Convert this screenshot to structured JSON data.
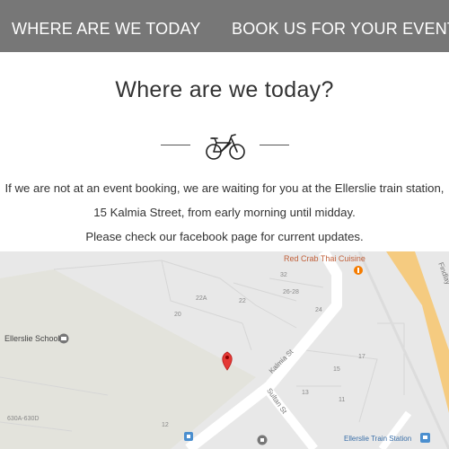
{
  "nav": {
    "left_label": "WHERE ARE WE TODAY",
    "right_label": "BOOK US FOR YOUR EVENT"
  },
  "main": {
    "title": "Where are we today?",
    "divider_icon": "bicycle-icon",
    "paragraph_1": "If we are not at an event booking, we are waiting for you at the Ellerslie train station,",
    "paragraph_2": "15 Kalmia Street, from early morning until midday.",
    "paragraph_3": "Please check our facebook page for current updates."
  },
  "map": {
    "pois": {
      "restaurant": "Red Crab Thai Cuisine",
      "school": "Ellerslie School",
      "station": "Ellerslie Train Station"
    },
    "streets": {
      "kalmia": "Kalmia St",
      "sultan": "Sultan St",
      "arterial": "Findlay"
    },
    "lot_numbers": [
      "32",
      "26-28",
      "22A",
      "22",
      "20",
      "24",
      "17",
      "15",
      "13",
      "11",
      "630A-630D",
      "12"
    ],
    "colors": {
      "background": "#e8e8e8",
      "road": "#ffffff",
      "arterial": "#f5cb80",
      "park": "#e0e0d8",
      "marker": "#e53935",
      "poi_orange": "#f57c00",
      "poi_blue": "#4b8fcf"
    }
  },
  "icons": {
    "bicycle": "bicycle-icon",
    "map_pin": "map-pin-icon",
    "restaurant": "restaurant-icon",
    "school": "school-icon",
    "train": "train-icon"
  }
}
